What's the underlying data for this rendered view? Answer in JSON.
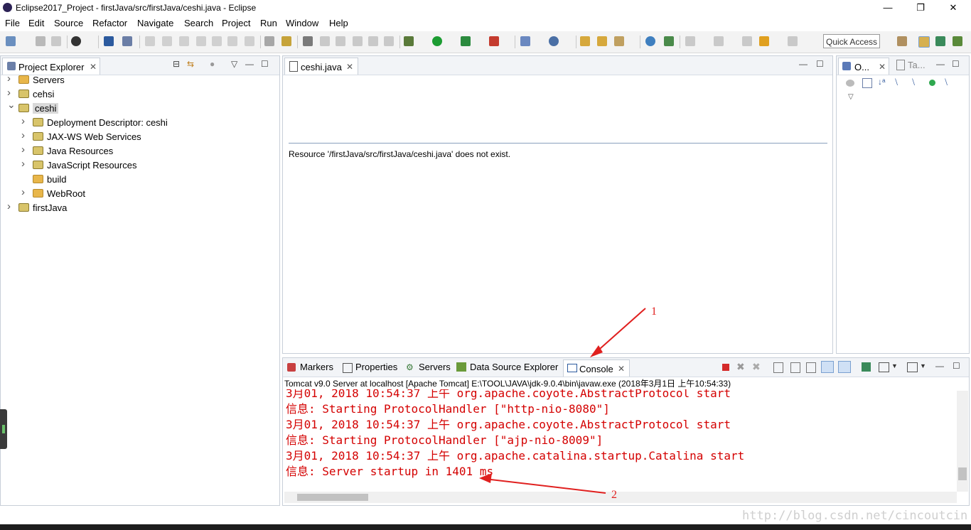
{
  "window": {
    "title": "Eclipse2017_Project - firstJava/src/firstJava/ceshi.java - Eclipse",
    "minimize": "—",
    "restore": "❐",
    "close": "✕"
  },
  "menu": {
    "items": [
      "File",
      "Edit",
      "Source",
      "Refactor",
      "Navigate",
      "Search",
      "Project",
      "Run",
      "Window",
      "Help"
    ]
  },
  "toolbar": {
    "quick_access": "Quick Access"
  },
  "project_explorer": {
    "tab_label": "Project Explorer",
    "close": "✕",
    "tree": [
      {
        "label": "Servers",
        "depth": 0,
        "expanded": false,
        "icon": "folder-icon"
      },
      {
        "label": "cehsi",
        "depth": 0,
        "expanded": false,
        "icon": "project-icon"
      },
      {
        "label": "ceshi",
        "depth": 0,
        "expanded": true,
        "icon": "project-icon",
        "selected": true
      },
      {
        "label": "Deployment Descriptor: ceshi",
        "depth": 1,
        "expanded": false,
        "icon": "descriptor-icon"
      },
      {
        "label": "JAX-WS Web Services",
        "depth": 1,
        "expanded": false,
        "icon": "webservice-icon"
      },
      {
        "label": "Java Resources",
        "depth": 1,
        "expanded": false,
        "icon": "java-resources-icon"
      },
      {
        "label": "JavaScript Resources",
        "depth": 1,
        "expanded": false,
        "icon": "js-resources-icon"
      },
      {
        "label": "build",
        "depth": 1,
        "expanded": null,
        "icon": "folder-icon"
      },
      {
        "label": "WebRoot",
        "depth": 1,
        "expanded": false,
        "icon": "folder-icon"
      },
      {
        "label": "firstJava",
        "depth": 0,
        "expanded": false,
        "icon": "project-icon"
      }
    ]
  },
  "editor": {
    "tab_label": "ceshi.java",
    "close": "✕",
    "message": "Resource '/firstJava/src/firstJava/ceshi.java' does not exist."
  },
  "outline": {
    "tab1": "O...",
    "tab2": "Ta...",
    "close": "✕"
  },
  "bottom_panel": {
    "tabs": [
      "Markers",
      "Properties",
      "Servers",
      "Data Source Explorer"
    ],
    "active_tab": "Console",
    "close": "✕",
    "console_header": "Tomcat v9.0 Server at localhost [Apache Tomcat] E:\\TOOL\\JAVA\\jdk-9.0.4\\bin\\javaw.exe (2018年3月1日 上午10:54:33)",
    "lines": [
      "3月01, 2018 10:54:37 上午 org.apache.coyote.AbstractProtocol start",
      "信息: Starting ProtocolHandler [\"http-nio-8080\"]",
      "3月01, 2018 10:54:37 上午 org.apache.coyote.AbstractProtocol start",
      "信息: Starting ProtocolHandler [\"ajp-nio-8009\"]",
      "3月01, 2018 10:54:37 上午 org.apache.catalina.startup.Catalina start",
      "信息: Server startup in 1401 ms"
    ]
  },
  "annotations": {
    "one": "1",
    "two": "2"
  },
  "watermark": "http://blog.csdn.net/cincoutcin",
  "colors": {
    "console_text": "#d40000",
    "annotation": "#e0201f"
  }
}
